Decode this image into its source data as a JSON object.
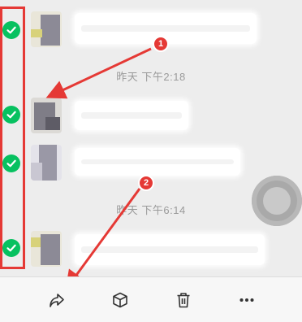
{
  "messages": {
    "timestamp_1": "昨天 下午2:18",
    "timestamp_2": "昨天 下午6:14"
  },
  "annotations": {
    "badge_1": "1",
    "badge_2": "2"
  },
  "toolbar": {
    "forward_icon": "forward-icon",
    "favorite_icon": "box-icon",
    "delete_icon": "trash-icon",
    "more_icon": "more-icon"
  },
  "colors": {
    "check": "#07c160",
    "annotation": "#e53935",
    "background": "#ededed"
  }
}
